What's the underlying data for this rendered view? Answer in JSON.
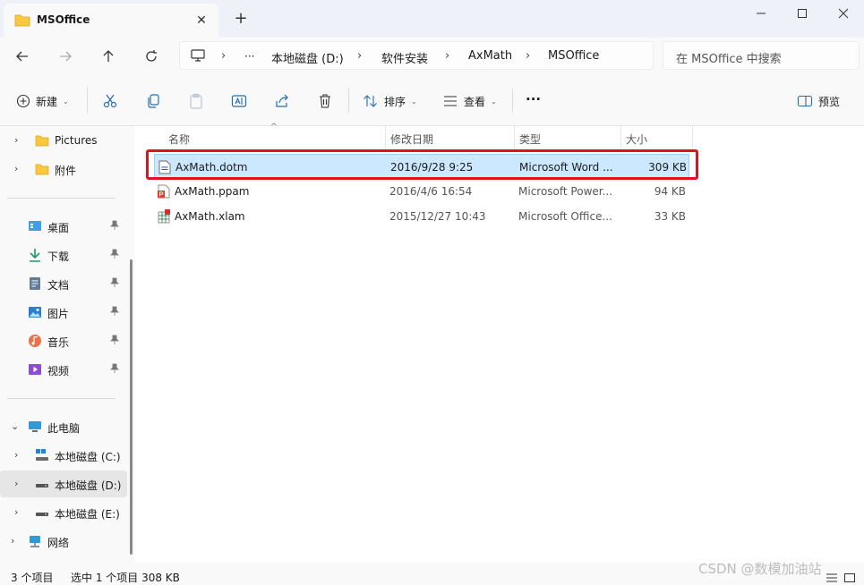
{
  "window": {
    "tab_title": "MSOffice",
    "new_tab_label": "+",
    "close_tab_label": "✕"
  },
  "address": {
    "crumbs": [
      "本地磁盘 (D:)",
      "软件安装",
      "AxMath",
      "MSOffice"
    ],
    "overflow": "···",
    "search_placeholder": "在 MSOffice 中搜索"
  },
  "toolbar": {
    "new_label": "新建",
    "sort_label": "排序",
    "view_label": "查看",
    "more_label": "···",
    "preview_label": "预览"
  },
  "sidebar": {
    "quick": [
      {
        "label": "Pictures",
        "icon": "folder-icon"
      },
      {
        "label": "附件",
        "icon": "folder-icon"
      }
    ],
    "pinned": [
      {
        "label": "桌面",
        "icon": "desktop-icon"
      },
      {
        "label": "下载",
        "icon": "download-icon"
      },
      {
        "label": "文档",
        "icon": "documents-icon"
      },
      {
        "label": "图片",
        "icon": "pictures-icon"
      },
      {
        "label": "音乐",
        "icon": "music-icon"
      },
      {
        "label": "视频",
        "icon": "videos-icon"
      }
    ],
    "this_pc": "此电脑",
    "drives": [
      {
        "label": "本地磁盘 (C:)",
        "icon": "drive-c-icon"
      },
      {
        "label": "本地磁盘 (D:)",
        "icon": "drive-icon"
      },
      {
        "label": "本地磁盘 (E:)",
        "icon": "drive-icon"
      }
    ],
    "network": "网络"
  },
  "columns": {
    "name": "名称",
    "modified": "修改日期",
    "type": "类型",
    "size": "大小"
  },
  "files": [
    {
      "name": "AxMath.dotm",
      "modified": "2016/9/28 9:25",
      "type": "Microsoft Word ...",
      "size": "309 KB",
      "icon": "word-template-icon",
      "selected": true
    },
    {
      "name": "AxMath.ppam",
      "modified": "2016/4/6 16:54",
      "type": "Microsoft Power...",
      "size": "94 KB",
      "icon": "powerpoint-addin-icon",
      "selected": false
    },
    {
      "name": "AxMath.xlam",
      "modified": "2015/12/27 10:43",
      "type": "Microsoft Office...",
      "size": "33 KB",
      "icon": "excel-addin-icon",
      "selected": false
    }
  ],
  "status": {
    "count": "3 个项目",
    "selection": "选中 1 个项目  308 KB"
  },
  "watermark": "CSDN @数模加油站",
  "colors": {
    "accent": "#0067c0",
    "selection_bg": "#cce8ff",
    "highlight_border": "#e0131d",
    "folder": "#f8c93e"
  }
}
